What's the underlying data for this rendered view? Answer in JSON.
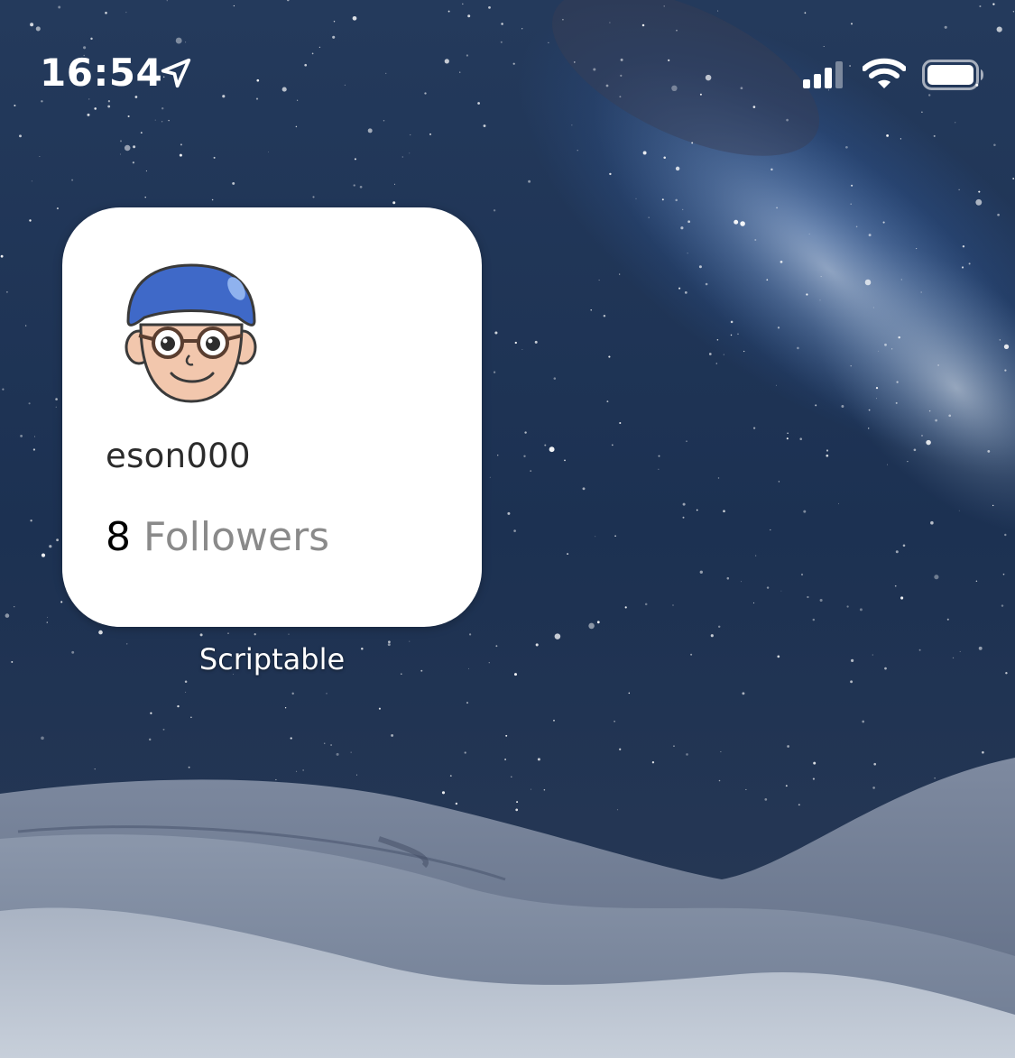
{
  "status_bar": {
    "time": "16:54",
    "location_icon": "location-arrow-icon",
    "signal_icon": "cellular-signal-icon",
    "wifi_icon": "wifi-icon",
    "battery_icon": "battery-full-icon"
  },
  "widget": {
    "avatar": "avatar-cartoon-face",
    "username": "eson000",
    "followers_count": "8",
    "followers_label": "Followers",
    "caption": "Scriptable"
  },
  "wallpaper": {
    "sky_color": "#1b2d49",
    "dune_color": "#aab4c4"
  }
}
